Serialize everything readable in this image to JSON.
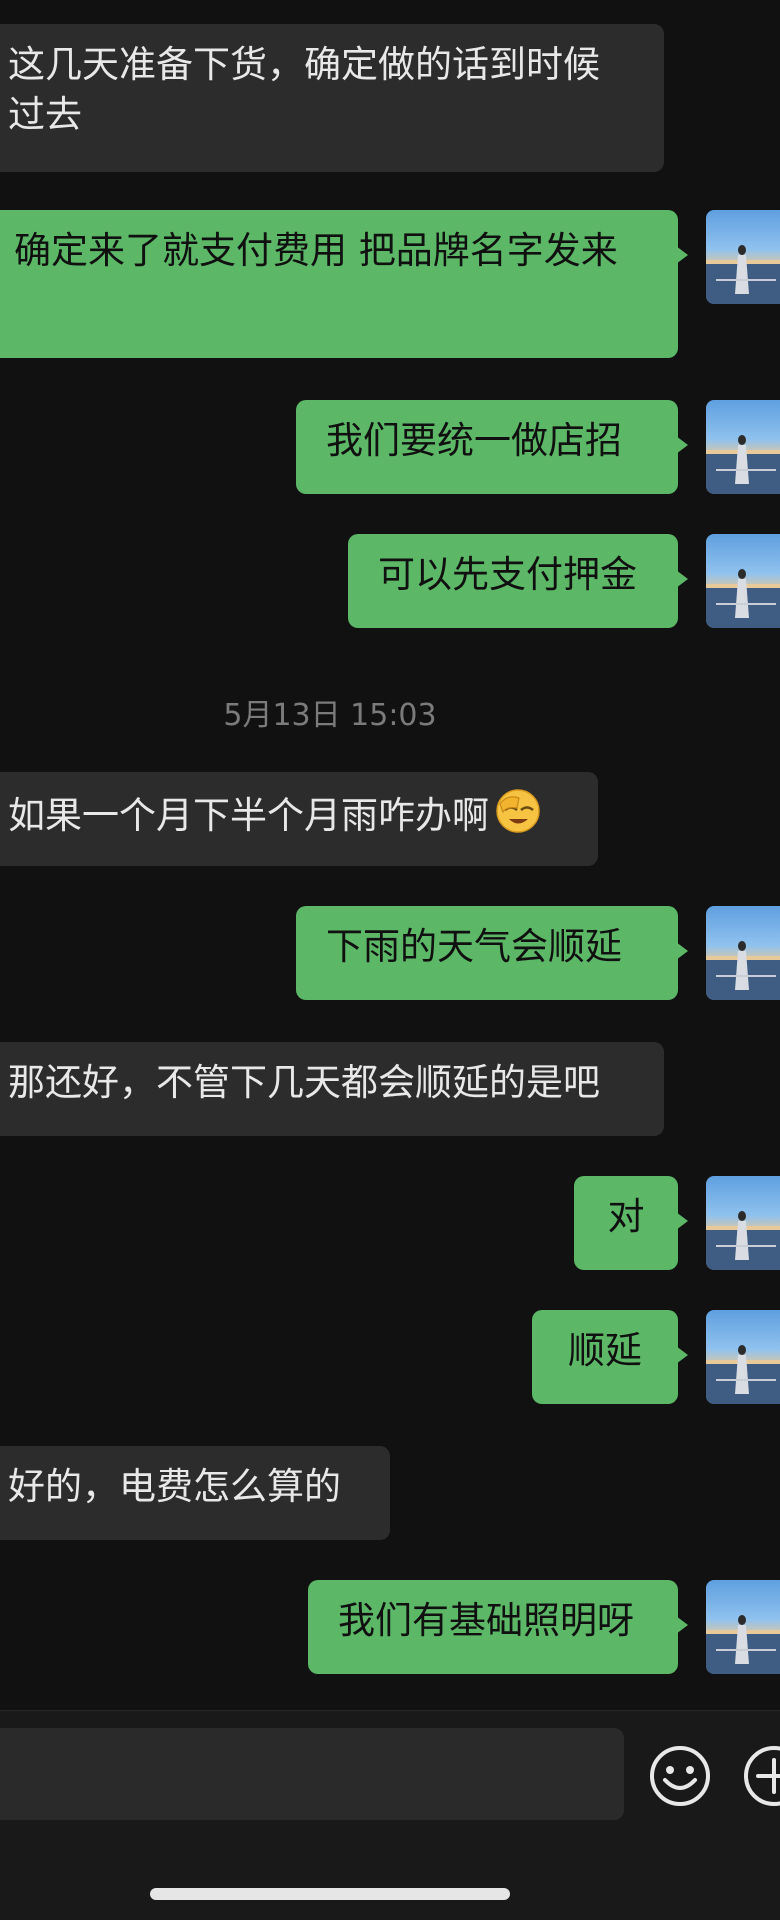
{
  "messages": [
    {
      "side": "in",
      "text": "这几天准备下货，确定做的话到时候",
      "text2": "过去"
    },
    {
      "side": "out",
      "text": "确定来了就支付费用 把品牌名字发来"
    },
    {
      "side": "out",
      "text": "我们要统一做店招"
    },
    {
      "side": "out",
      "text": "可以先支付押金"
    },
    {
      "side": "in",
      "text": "如果一个月下半个月雨咋办啊",
      "emoji": "🤦"
    },
    {
      "side": "out",
      "text": "下雨的天气会顺延"
    },
    {
      "side": "in",
      "text": "那还好，不管下几天都会顺延的是吧"
    },
    {
      "side": "out",
      "text": "对"
    },
    {
      "side": "out",
      "text": "顺延"
    },
    {
      "side": "in",
      "text": "好的，电费怎么算的"
    },
    {
      "side": "out",
      "text": "我们有基础照明呀"
    }
  ],
  "timestamp": "5月13日 15:03",
  "input": {
    "placeholder": ""
  },
  "icons": {
    "emoji_button": "smiley-face-icon",
    "plus_button": "plus-circle-icon",
    "avatar": "user-avatar-photo"
  },
  "colors": {
    "background": "#111111",
    "incoming_bubble": "#2c2c2c",
    "outgoing_bubble": "#5cb867",
    "timestamp": "#7b7b7b"
  }
}
